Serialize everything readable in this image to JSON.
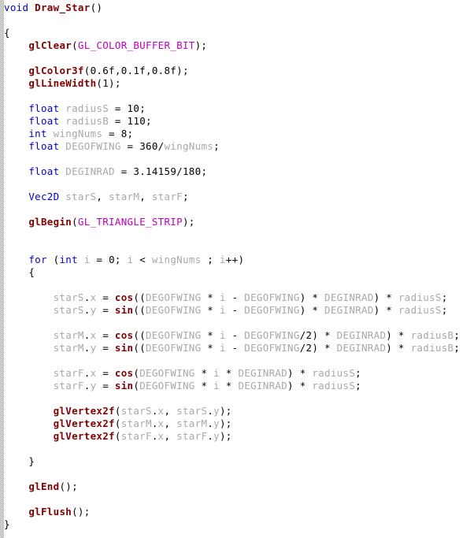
{
  "editor": {
    "language": "C++",
    "gutter_name": "selection-margin",
    "colors": {
      "background": "#ffffff",
      "keyword": "#0000d0",
      "function": "#800000",
      "identifier": "#a8a8a8",
      "macro": "#c000c0",
      "punctuation": "#000000",
      "gutter": "#9a9a9a"
    }
  },
  "code": {
    "lines": [
      {
        "indent": 0,
        "tokens": [
          {
            "t": "kw",
            "s": "void"
          },
          {
            "t": "pun",
            "s": " "
          },
          {
            "t": "fn",
            "s": "Draw_Star"
          },
          {
            "t": "pun",
            "s": "()"
          }
        ]
      },
      {
        "indent": 0,
        "tokens": []
      },
      {
        "indent": 0,
        "tokens": [
          {
            "t": "pun",
            "s": "{"
          }
        ]
      },
      {
        "indent": 1,
        "tokens": [
          {
            "t": "fn",
            "s": "glClear"
          },
          {
            "t": "pun",
            "s": "("
          },
          {
            "t": "mac",
            "s": "GL_COLOR_BUFFER_BIT"
          },
          {
            "t": "pun",
            "s": ");"
          }
        ]
      },
      {
        "indent": 0,
        "tokens": []
      },
      {
        "indent": 1,
        "tokens": [
          {
            "t": "fn",
            "s": "glColor3f"
          },
          {
            "t": "pun",
            "s": "(0.6f,0.1f,0.8f);"
          }
        ]
      },
      {
        "indent": 1,
        "tokens": [
          {
            "t": "fn",
            "s": "glLineWidth"
          },
          {
            "t": "pun",
            "s": "(1);"
          }
        ]
      },
      {
        "indent": 0,
        "tokens": []
      },
      {
        "indent": 1,
        "tokens": [
          {
            "t": "kw",
            "s": "float"
          },
          {
            "t": "pun",
            "s": " "
          },
          {
            "t": "id",
            "s": "radiusS"
          },
          {
            "t": "pun",
            "s": " = 10;"
          }
        ]
      },
      {
        "indent": 1,
        "tokens": [
          {
            "t": "kw",
            "s": "float"
          },
          {
            "t": "pun",
            "s": " "
          },
          {
            "t": "id",
            "s": "radiusB"
          },
          {
            "t": "pun",
            "s": " = 110;"
          }
        ]
      },
      {
        "indent": 1,
        "tokens": [
          {
            "t": "kw",
            "s": "int"
          },
          {
            "t": "pun",
            "s": " "
          },
          {
            "t": "id",
            "s": "wingNums"
          },
          {
            "t": "pun",
            "s": " = 8;"
          }
        ]
      },
      {
        "indent": 1,
        "tokens": [
          {
            "t": "kw",
            "s": "float"
          },
          {
            "t": "pun",
            "s": " "
          },
          {
            "t": "id",
            "s": "DEGOFWING"
          },
          {
            "t": "pun",
            "s": " = 360/"
          },
          {
            "t": "id",
            "s": "wingNums"
          },
          {
            "t": "pun",
            "s": ";"
          }
        ]
      },
      {
        "indent": 0,
        "tokens": []
      },
      {
        "indent": 1,
        "tokens": [
          {
            "t": "kw",
            "s": "float"
          },
          {
            "t": "pun",
            "s": " "
          },
          {
            "t": "id",
            "s": "DEGINRAD"
          },
          {
            "t": "pun",
            "s": " = 3.14159/180;"
          }
        ]
      },
      {
        "indent": 0,
        "tokens": []
      },
      {
        "indent": 1,
        "tokens": [
          {
            "t": "type",
            "s": "Vec2D"
          },
          {
            "t": "pun",
            "s": " "
          },
          {
            "t": "id",
            "s": "starS"
          },
          {
            "t": "pun",
            "s": ", "
          },
          {
            "t": "id",
            "s": "starM"
          },
          {
            "t": "pun",
            "s": ", "
          },
          {
            "t": "id",
            "s": "starF"
          },
          {
            "t": "pun",
            "s": ";"
          }
        ]
      },
      {
        "indent": 0,
        "tokens": []
      },
      {
        "indent": 1,
        "tokens": [
          {
            "t": "fn",
            "s": "glBegin"
          },
          {
            "t": "pun",
            "s": "("
          },
          {
            "t": "mac",
            "s": "GL_TRIANGLE_STRIP"
          },
          {
            "t": "pun",
            "s": ");"
          }
        ]
      },
      {
        "indent": 0,
        "tokens": []
      },
      {
        "indent": 0,
        "tokens": []
      },
      {
        "indent": 1,
        "tokens": [
          {
            "t": "kw",
            "s": "for"
          },
          {
            "t": "pun",
            "s": " ("
          },
          {
            "t": "kw",
            "s": "int"
          },
          {
            "t": "pun",
            "s": " "
          },
          {
            "t": "id",
            "s": "i"
          },
          {
            "t": "pun",
            "s": " = 0; "
          },
          {
            "t": "id",
            "s": "i"
          },
          {
            "t": "pun",
            "s": " < "
          },
          {
            "t": "id",
            "s": "wingNums"
          },
          {
            "t": "pun",
            "s": " ; "
          },
          {
            "t": "id",
            "s": "i"
          },
          {
            "t": "pun",
            "s": "++)"
          }
        ]
      },
      {
        "indent": 1,
        "tokens": [
          {
            "t": "pun",
            "s": "{"
          }
        ]
      },
      {
        "indent": 0,
        "tokens": []
      },
      {
        "indent": 2,
        "tokens": [
          {
            "t": "id",
            "s": "starS"
          },
          {
            "t": "pun",
            "s": "."
          },
          {
            "t": "id",
            "s": "x"
          },
          {
            "t": "pun",
            "s": " = "
          },
          {
            "t": "fn",
            "s": "cos"
          },
          {
            "t": "pun",
            "s": "(("
          },
          {
            "t": "id",
            "s": "DEGOFWING"
          },
          {
            "t": "pun",
            "s": " * "
          },
          {
            "t": "id",
            "s": "i"
          },
          {
            "t": "pun",
            "s": " - "
          },
          {
            "t": "id",
            "s": "DEGOFWING"
          },
          {
            "t": "pun",
            "s": ") * "
          },
          {
            "t": "id",
            "s": "DEGINRAD"
          },
          {
            "t": "pun",
            "s": ") * "
          },
          {
            "t": "id",
            "s": "radiusS"
          },
          {
            "t": "pun",
            "s": ";"
          }
        ]
      },
      {
        "indent": 2,
        "tokens": [
          {
            "t": "id",
            "s": "starS"
          },
          {
            "t": "pun",
            "s": "."
          },
          {
            "t": "id",
            "s": "y"
          },
          {
            "t": "pun",
            "s": " = "
          },
          {
            "t": "fn",
            "s": "sin"
          },
          {
            "t": "pun",
            "s": "(("
          },
          {
            "t": "id",
            "s": "DEGOFWING"
          },
          {
            "t": "pun",
            "s": " * "
          },
          {
            "t": "id",
            "s": "i"
          },
          {
            "t": "pun",
            "s": " - "
          },
          {
            "t": "id",
            "s": "DEGOFWING"
          },
          {
            "t": "pun",
            "s": ") * "
          },
          {
            "t": "id",
            "s": "DEGINRAD"
          },
          {
            "t": "pun",
            "s": ") * "
          },
          {
            "t": "id",
            "s": "radiusS"
          },
          {
            "t": "pun",
            "s": ";"
          }
        ]
      },
      {
        "indent": 0,
        "tokens": []
      },
      {
        "indent": 2,
        "tokens": [
          {
            "t": "id",
            "s": "starM"
          },
          {
            "t": "pun",
            "s": "."
          },
          {
            "t": "id",
            "s": "x"
          },
          {
            "t": "pun",
            "s": " = "
          },
          {
            "t": "fn",
            "s": "cos"
          },
          {
            "t": "pun",
            "s": "(("
          },
          {
            "t": "id",
            "s": "DEGOFWING"
          },
          {
            "t": "pun",
            "s": " * "
          },
          {
            "t": "id",
            "s": "i"
          },
          {
            "t": "pun",
            "s": " - "
          },
          {
            "t": "id",
            "s": "DEGOFWING"
          },
          {
            "t": "pun",
            "s": "/2) * "
          },
          {
            "t": "id",
            "s": "DEGINRAD"
          },
          {
            "t": "pun",
            "s": ") * "
          },
          {
            "t": "id",
            "s": "radiusB"
          },
          {
            "t": "pun",
            "s": ";"
          }
        ]
      },
      {
        "indent": 2,
        "tokens": [
          {
            "t": "id",
            "s": "starM"
          },
          {
            "t": "pun",
            "s": "."
          },
          {
            "t": "id",
            "s": "y"
          },
          {
            "t": "pun",
            "s": " = "
          },
          {
            "t": "fn",
            "s": "sin"
          },
          {
            "t": "pun",
            "s": "(("
          },
          {
            "t": "id",
            "s": "DEGOFWING"
          },
          {
            "t": "pun",
            "s": " * "
          },
          {
            "t": "id",
            "s": "i"
          },
          {
            "t": "pun",
            "s": " - "
          },
          {
            "t": "id",
            "s": "DEGOFWING"
          },
          {
            "t": "pun",
            "s": "/2) * "
          },
          {
            "t": "id",
            "s": "DEGINRAD"
          },
          {
            "t": "pun",
            "s": ") * "
          },
          {
            "t": "id",
            "s": "radiusB"
          },
          {
            "t": "pun",
            "s": ";"
          }
        ]
      },
      {
        "indent": 0,
        "tokens": []
      },
      {
        "indent": 2,
        "tokens": [
          {
            "t": "id",
            "s": "starF"
          },
          {
            "t": "pun",
            "s": "."
          },
          {
            "t": "id",
            "s": "x"
          },
          {
            "t": "pun",
            "s": " = "
          },
          {
            "t": "fn",
            "s": "cos"
          },
          {
            "t": "pun",
            "s": "("
          },
          {
            "t": "id",
            "s": "DEGOFWING"
          },
          {
            "t": "pun",
            "s": " * "
          },
          {
            "t": "id",
            "s": "i"
          },
          {
            "t": "pun",
            "s": " * "
          },
          {
            "t": "id",
            "s": "DEGINRAD"
          },
          {
            "t": "pun",
            "s": ") * "
          },
          {
            "t": "id",
            "s": "radiusS"
          },
          {
            "t": "pun",
            "s": ";"
          }
        ]
      },
      {
        "indent": 2,
        "tokens": [
          {
            "t": "id",
            "s": "starF"
          },
          {
            "t": "pun",
            "s": "."
          },
          {
            "t": "id",
            "s": "y"
          },
          {
            "t": "pun",
            "s": " = "
          },
          {
            "t": "fn",
            "s": "sin"
          },
          {
            "t": "pun",
            "s": "("
          },
          {
            "t": "id",
            "s": "DEGOFWING"
          },
          {
            "t": "pun",
            "s": " * "
          },
          {
            "t": "id",
            "s": "i"
          },
          {
            "t": "pun",
            "s": " * "
          },
          {
            "t": "id",
            "s": "DEGINRAD"
          },
          {
            "t": "pun",
            "s": ") * "
          },
          {
            "t": "id",
            "s": "radiusS"
          },
          {
            "t": "pun",
            "s": ";"
          }
        ]
      },
      {
        "indent": 0,
        "tokens": []
      },
      {
        "indent": 2,
        "tokens": [
          {
            "t": "fn",
            "s": "glVertex2f"
          },
          {
            "t": "pun",
            "s": "("
          },
          {
            "t": "id",
            "s": "starS"
          },
          {
            "t": "pun",
            "s": "."
          },
          {
            "t": "id",
            "s": "x"
          },
          {
            "t": "pun",
            "s": ", "
          },
          {
            "t": "id",
            "s": "starS"
          },
          {
            "t": "pun",
            "s": "."
          },
          {
            "t": "id",
            "s": "y"
          },
          {
            "t": "pun",
            "s": ");"
          }
        ]
      },
      {
        "indent": 2,
        "tokens": [
          {
            "t": "fn",
            "s": "glVertex2f"
          },
          {
            "t": "pun",
            "s": "("
          },
          {
            "t": "id",
            "s": "starM"
          },
          {
            "t": "pun",
            "s": "."
          },
          {
            "t": "id",
            "s": "x"
          },
          {
            "t": "pun",
            "s": ", "
          },
          {
            "t": "id",
            "s": "starM"
          },
          {
            "t": "pun",
            "s": "."
          },
          {
            "t": "id",
            "s": "y"
          },
          {
            "t": "pun",
            "s": ");"
          }
        ]
      },
      {
        "indent": 2,
        "tokens": [
          {
            "t": "fn",
            "s": "glVertex2f"
          },
          {
            "t": "pun",
            "s": "("
          },
          {
            "t": "id",
            "s": "starF"
          },
          {
            "t": "pun",
            "s": "."
          },
          {
            "t": "id",
            "s": "x"
          },
          {
            "t": "pun",
            "s": ", "
          },
          {
            "t": "id",
            "s": "starF"
          },
          {
            "t": "pun",
            "s": "."
          },
          {
            "t": "id",
            "s": "y"
          },
          {
            "t": "pun",
            "s": ");"
          }
        ]
      },
      {
        "indent": 0,
        "tokens": []
      },
      {
        "indent": 1,
        "tokens": [
          {
            "t": "pun",
            "s": "}"
          }
        ]
      },
      {
        "indent": 0,
        "tokens": []
      },
      {
        "indent": 1,
        "tokens": [
          {
            "t": "fn",
            "s": "glEnd"
          },
          {
            "t": "pun",
            "s": "();"
          }
        ]
      },
      {
        "indent": 0,
        "tokens": []
      },
      {
        "indent": 1,
        "tokens": [
          {
            "t": "fn",
            "s": "glFlush"
          },
          {
            "t": "pun",
            "s": "();"
          }
        ]
      },
      {
        "indent": 0,
        "tokens": [
          {
            "t": "pun",
            "s": "}"
          }
        ]
      }
    ]
  }
}
